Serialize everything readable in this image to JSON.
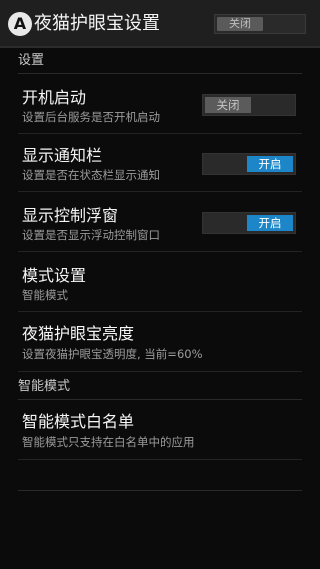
{
  "header": {
    "app_icon_letter": "A",
    "title": "夜猫护眼宝设置",
    "master_toggle_label": "关闭"
  },
  "sections": {
    "settings_header": "设置",
    "smart_mode_header": "智能模式"
  },
  "items": {
    "boot_start": {
      "title": "开机启动",
      "summary": "设置后台服务是否开机启动",
      "toggle_label": "关闭"
    },
    "notification_bar": {
      "title": "显示通知栏",
      "summary": "设置是否在状态栏显示通知",
      "toggle_label": "开启"
    },
    "floating_window": {
      "title": "显示控制浮窗",
      "summary": "设置是否显示浮动控制窗口",
      "toggle_label": "开启"
    },
    "mode_setting": {
      "title": "模式设置",
      "summary": "智能模式"
    },
    "brightness": {
      "title": "夜猫护眼宝亮度",
      "summary": "设置夜猫护眼宝透明度, 当前=60%"
    },
    "whitelist": {
      "title": "智能模式白名单",
      "summary": "智能模式只支持在白名单中的应用"
    }
  },
  "colors": {
    "accent_on": "#1d86c8",
    "toggle_off": "#5b5b5b",
    "background": "#0b0b0b"
  }
}
